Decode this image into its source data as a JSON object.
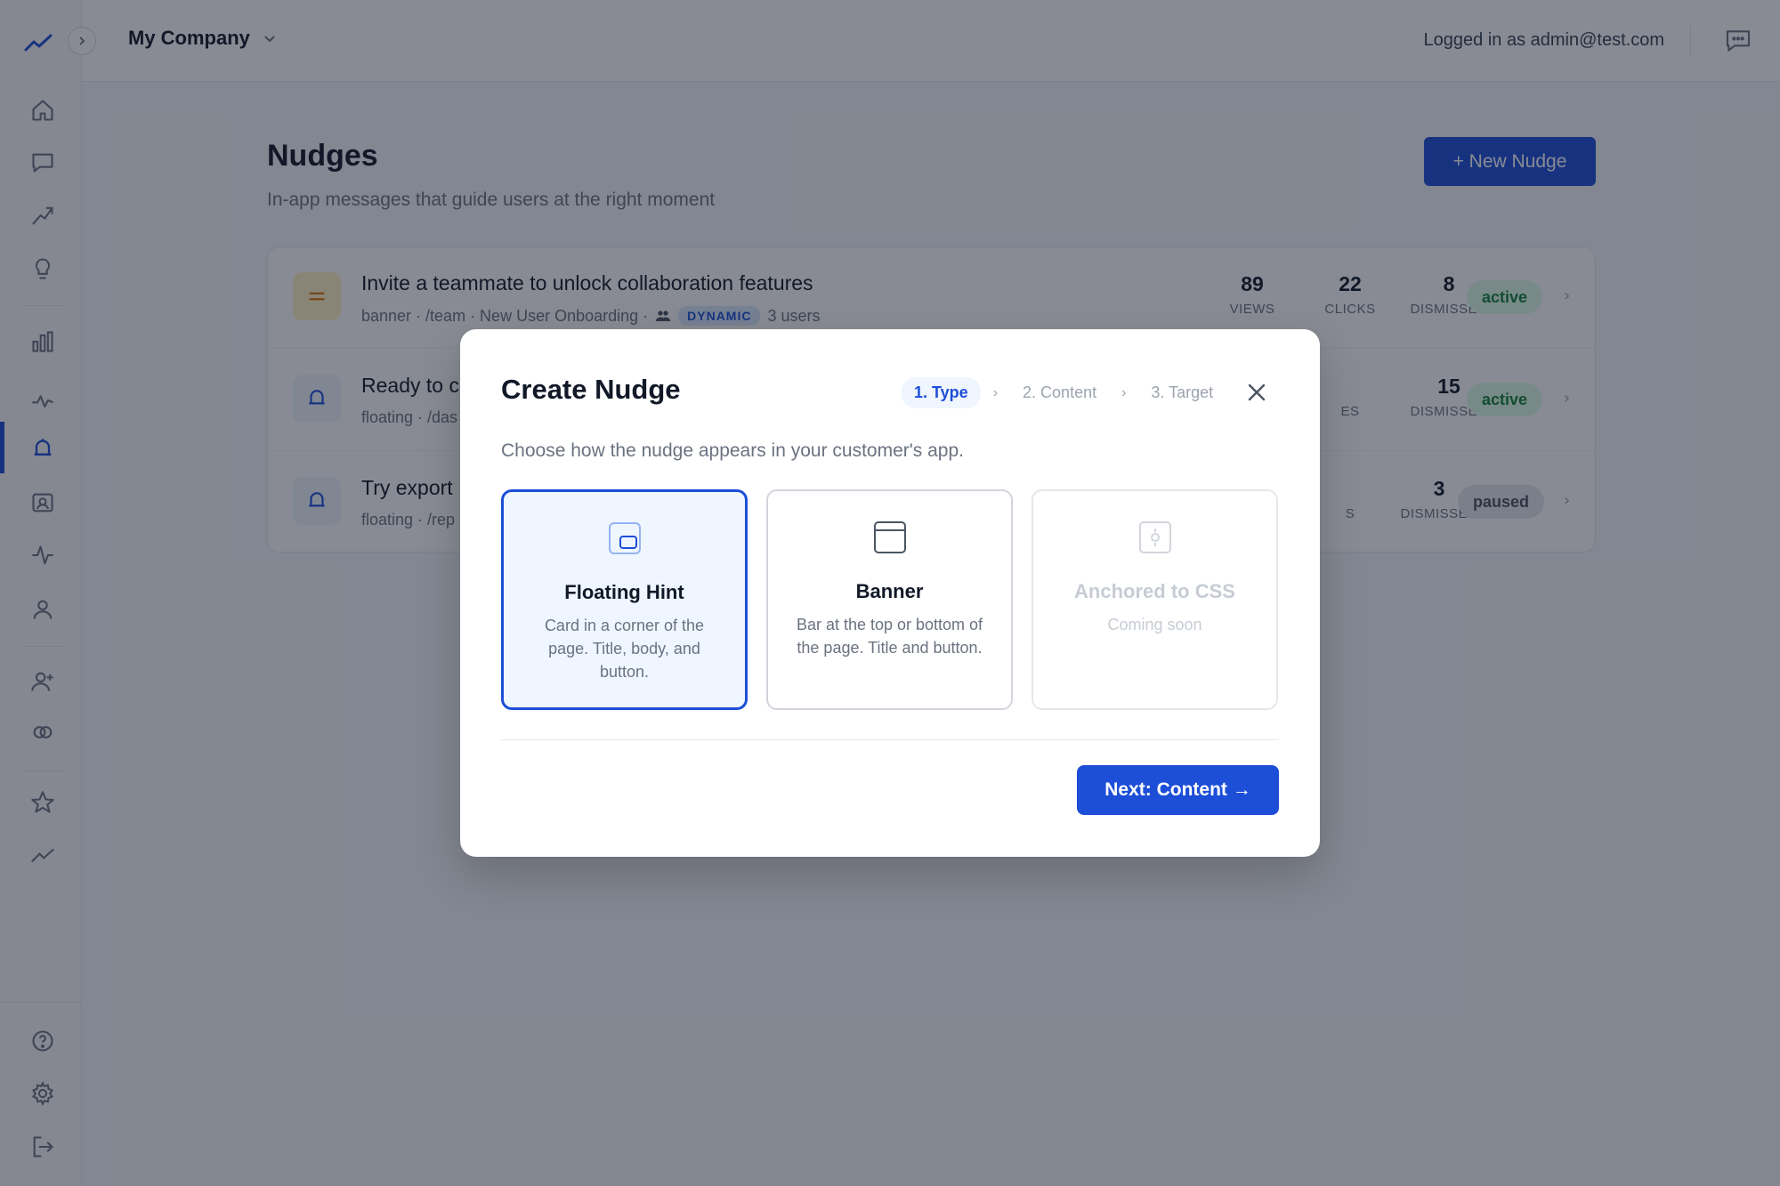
{
  "header": {
    "company_name": "My Company",
    "login_text": "Logged in as admin@test.com"
  },
  "sidebar": {
    "icons": [
      "trend-logo-icon",
      "home-icon",
      "chat-icon",
      "analytics-icon",
      "lightbulb-icon",
      "bar-chart-icon",
      "pulse-icon",
      "bell-icon",
      "id-card-icon",
      "activity-icon",
      "user-icon",
      "add-user-icon",
      "segments-icon",
      "star-icon",
      "trending-icon",
      "help-icon",
      "settings-icon",
      "logout-icon"
    ],
    "active_item": "nudges"
  },
  "page": {
    "title": "Nudges",
    "subtitle": "In-app messages that guide users at the right moment",
    "new_button": "+ New Nudge"
  },
  "nudges": [
    {
      "title": "Invite a teammate to unlock collaboration features",
      "meta": "banner · /team · New User Onboarding ·",
      "badge": "DYNAMIC",
      "users": "3 users",
      "views": "89",
      "views_label": "VIEWS",
      "clicks": "22",
      "clicks_label": "CLICKS",
      "dismissed": "8",
      "dismissed_label": "DISMISSED",
      "status": "active"
    },
    {
      "title": "Ready to c",
      "meta": "floating · /das",
      "dismissed": "15",
      "dismissed_label": "DISMISSED",
      "partial_label": "ES",
      "status": "active"
    },
    {
      "title": "Try export",
      "meta": "floating · /rep",
      "dismissed": "3",
      "dismissed_label": "DISMISSED",
      "partial_label": "S",
      "status": "paused"
    }
  ],
  "modal": {
    "title": "Create Nudge",
    "steps": [
      "1. Type",
      "2. Content",
      "3. Target"
    ],
    "description": "Choose how the nudge appears in your customer's app.",
    "types": [
      {
        "title": "Floating Hint",
        "desc": "Card in a corner of the page. Title, body, and button.",
        "icon": "floating-hint-icon"
      },
      {
        "title": "Banner",
        "desc": "Bar at the top or bottom of the page. Title and button.",
        "icon": "banner-icon"
      },
      {
        "title": "Anchored to CSS",
        "desc": "Coming soon",
        "icon": "anchor-target-icon"
      }
    ],
    "next_button": "Next: Content →"
  },
  "colors": {
    "primary": "#1d4ed8",
    "active_green": "#15803d",
    "active_bg": "#dcfce7",
    "paused_bg": "#e5e7eb",
    "overlay": "rgba(17,24,39,0.5)"
  }
}
